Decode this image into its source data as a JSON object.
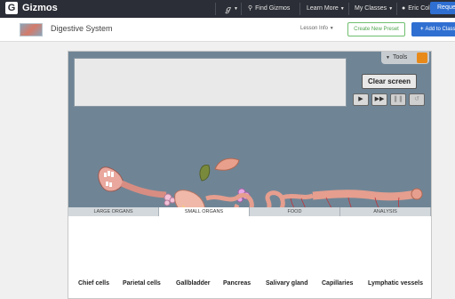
{
  "app": {
    "logo_letter": "G",
    "name": "Gizmos"
  },
  "topnav": {
    "tools_glyph": "ℊ",
    "find": "Find Gizmos",
    "learn_more": "Learn More",
    "my_classes": "My Classes",
    "user": "Eric Collins",
    "request": "Request"
  },
  "header": {
    "title": "Digestive System",
    "lesson_info": "Lesson Info",
    "create_preset": "Create New Preset",
    "add_to_class": "Add to Class"
  },
  "sim": {
    "tools": "Tools",
    "clear_screen": "Clear screen",
    "controls": [
      "▶",
      "▶▶",
      "❚❚",
      "↺"
    ]
  },
  "tabs": [
    "LARGE ORGANS",
    "SMALL ORGANS",
    "FOOD",
    "ANALYSIS"
  ],
  "active_tab": "SMALL ORGANS",
  "small_organs": [
    "Chief cells",
    "Parietal cells",
    "Gallbladder",
    "Pancreas",
    "Salivary gland",
    "Capillaries",
    "Lymphatic vessels"
  ],
  "colors": {
    "nav_bg": "#2b2e36",
    "accent": "#2f6fd1",
    "sim_bg": "#6f8596",
    "create_green": "#4fa44f"
  }
}
